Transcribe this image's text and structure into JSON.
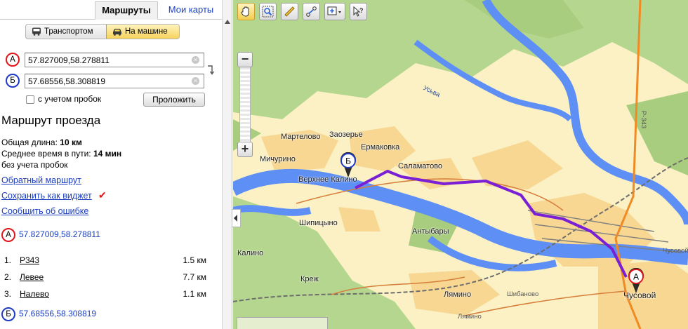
{
  "tabs": {
    "routes": "Маршруты",
    "my_maps": "Мои карты"
  },
  "modes": {
    "transport": "Транспортом",
    "car": "На машине",
    "selected": "car"
  },
  "points": {
    "a": {
      "letter": "А",
      "value": "57.827009,58.278811"
    },
    "b": {
      "letter": "Б",
      "value": "57.68556,58.308819"
    }
  },
  "traffic": {
    "label": "с учетом пробок",
    "checked": false
  },
  "build_button": "Проложить",
  "route": {
    "title": "Маршрут проезда",
    "length_label": "Общая длина:",
    "length_value": "10 км",
    "time_label": "Среднее время в пути:",
    "time_value": "14 мин",
    "no_traffic_note": "без учета пробок"
  },
  "links": {
    "reverse": "Обратный маршрут",
    "save_widget": "Сохранить как виджет",
    "report_error": "Сообщить об ошибке"
  },
  "steps": [
    {
      "num": "1.",
      "name": "Р343",
      "dist": "1.5 км"
    },
    {
      "num": "2.",
      "name": "Левее",
      "dist": "7.7 км"
    },
    {
      "num": "3.",
      "name": "Налево",
      "dist": "1.1 км"
    }
  ],
  "map": {
    "places": {
      "martelovo": "Мартелово",
      "zaozerie": "Заозерье",
      "ermakovka": "Ермаковка",
      "michurino": "Мичурино",
      "salamatovo": "Саламатово",
      "verkhnee_kalino": "Верхнее Калино",
      "shipitsyno": "Шипицыно",
      "antybary": "Антыбары",
      "kalino": "Калино",
      "krezh": "Креж",
      "lyamino": "Лямино",
      "shibanovo": "Шибаново",
      "chusovoy": "Чусовой",
      "chusovoy_edge": "Чусовой",
      "lyamino_bottom": "Лямино"
    },
    "road_label": "Р-343",
    "river_label": "Усьва",
    "colors": {
      "water": "#5e8ff5",
      "forest": "#b5d68e",
      "settlement": "#f7d792",
      "route": "#7a1fd6",
      "highway": "#f08a24"
    }
  }
}
